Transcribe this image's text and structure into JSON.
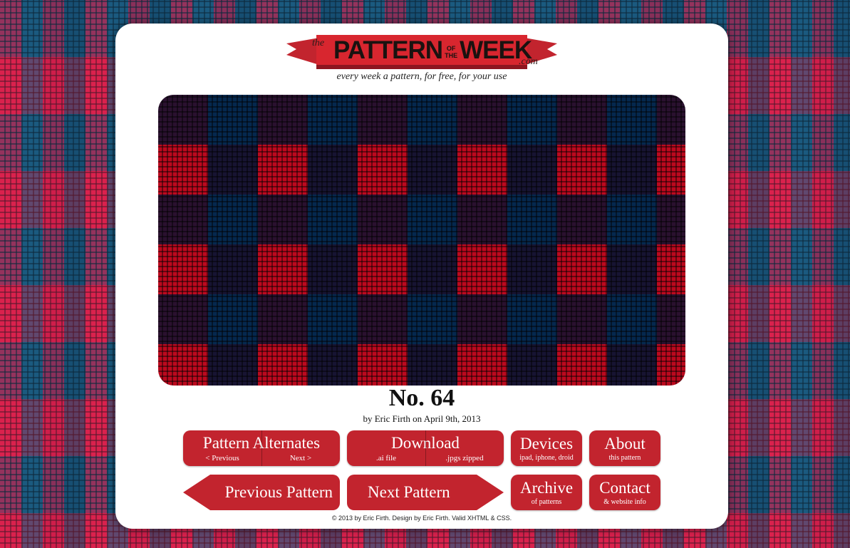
{
  "logo": {
    "the": "the",
    "main": "PATTERN",
    "of_the": "OF THE",
    "week": "WEEK",
    "dotcom": ".com"
  },
  "tagline": "every week a pattern, for free, for your use",
  "issue": "No. 64",
  "byline": "by Eric Firth on April 9th, 2013",
  "buttons": {
    "alternates": {
      "title": "Pattern Alternates",
      "left": "< Previous",
      "right": "Next >"
    },
    "download": {
      "title": "Download",
      "left": ".ai file",
      "right": ".jpgs zipped"
    },
    "devices": {
      "title": "Devices",
      "sub": "ipad, iphone, droid"
    },
    "about": {
      "title": "About",
      "sub": "this pattern"
    },
    "previous": "Previous Pattern",
    "next": "Next Pattern",
    "archive": {
      "title": "Archive",
      "sub": "of patterns"
    },
    "contact": {
      "title": "Contact",
      "sub": "& website info"
    }
  },
  "footer": "© 2013 by Eric Firth. Design by Eric Firth. Valid XHTML & CSS.",
  "colors": {
    "accent": "#c2242e",
    "pattern_red": "#e02a57",
    "pattern_blue": "#1b6390"
  }
}
